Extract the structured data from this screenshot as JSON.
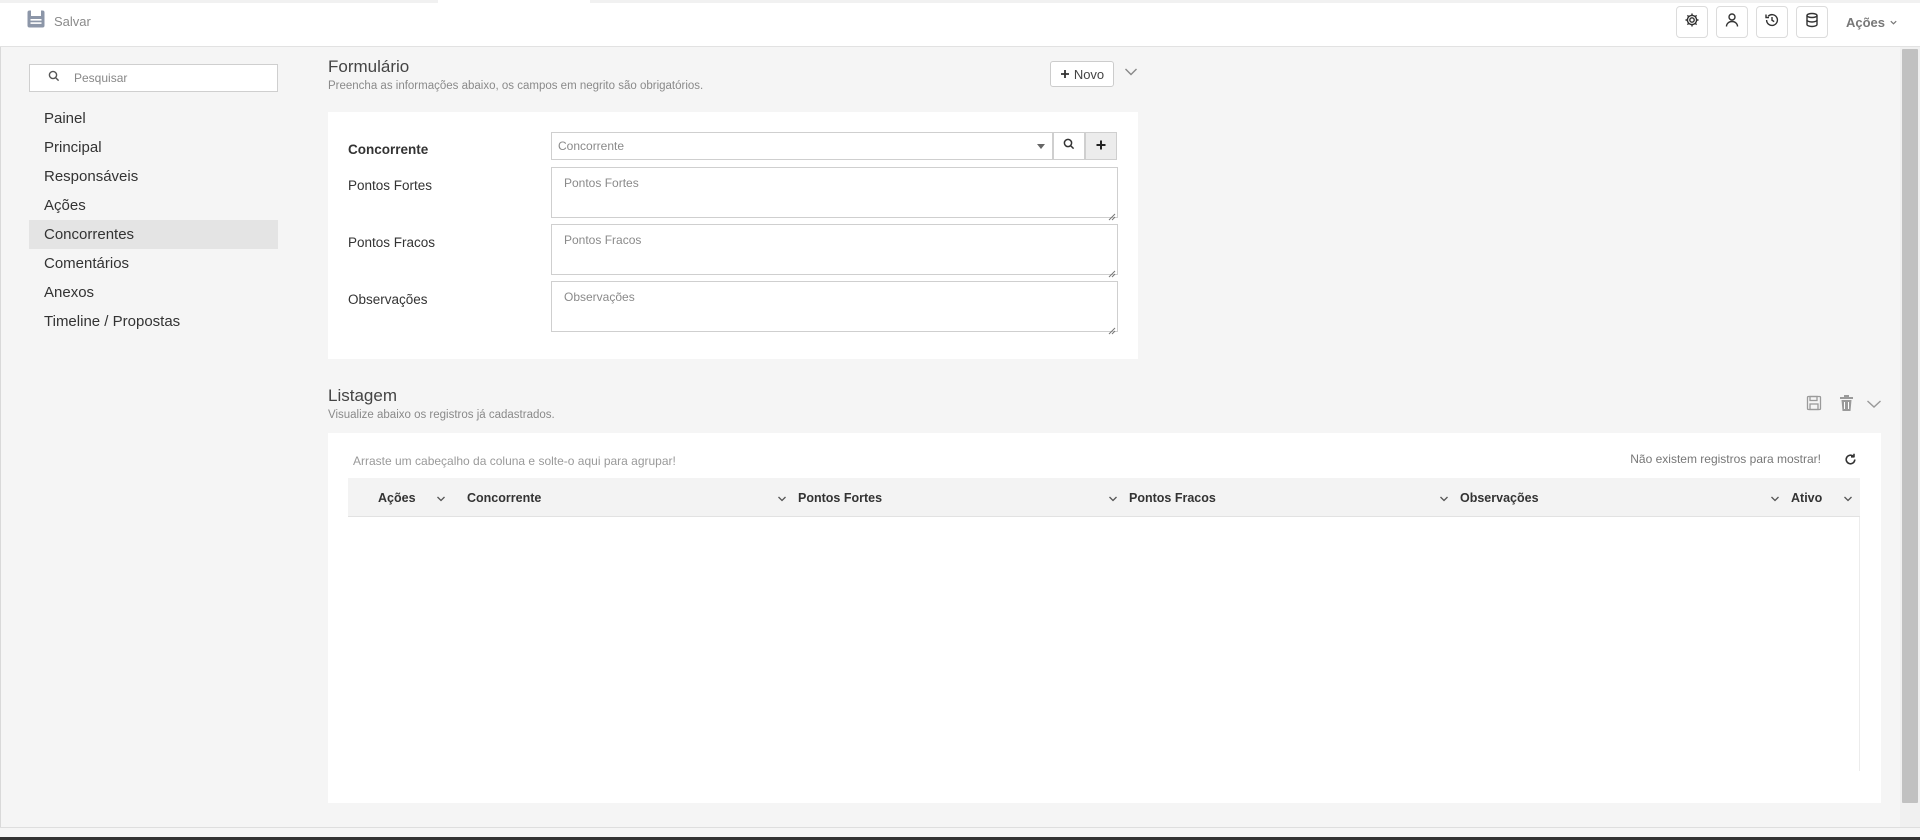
{
  "toolbar": {
    "save_label": "Salvar",
    "actions_label": "Ações",
    "icons": [
      "gear-icon",
      "user-icon",
      "history-icon",
      "database-icon"
    ]
  },
  "sidebar": {
    "search_placeholder": "Pesquisar",
    "items": [
      {
        "label": "Painel",
        "active": false
      },
      {
        "label": "Principal",
        "active": false
      },
      {
        "label": "Responsáveis",
        "active": false
      },
      {
        "label": "Ações",
        "active": false
      },
      {
        "label": "Concorrentes",
        "active": true
      },
      {
        "label": "Comentários",
        "active": false
      },
      {
        "label": "Anexos",
        "active": false
      },
      {
        "label": "Timeline / Propostas",
        "active": false
      }
    ]
  },
  "form": {
    "title": "Formulário",
    "subtitle": "Preencha as informações abaixo, os campos em negrito são obrigatórios.",
    "new_button": "Novo",
    "fields": {
      "concorrente": {
        "label": "Concorrente",
        "placeholder": "Concorrente"
      },
      "pontos_fortes": {
        "label": "Pontos Fortes",
        "placeholder": "Pontos Fortes"
      },
      "pontos_fracos": {
        "label": "Pontos Fracos",
        "placeholder": "Pontos Fracos"
      },
      "observacoes": {
        "label": "Observações",
        "placeholder": "Observações"
      }
    }
  },
  "listing": {
    "title": "Listagem",
    "subtitle": "Visualize abaixo os registros já cadastrados.",
    "group_hint": "Arraste um cabeçalho da coluna e solte-o aqui para agrupar!",
    "empty_message": "Não existem registros para mostrar!",
    "columns": [
      "Ações",
      "Concorrente",
      "Pontos Fortes",
      "Pontos Fracos",
      "Observações",
      "Ativo"
    ]
  },
  "colors": {
    "content_bg": "#f5f5f5",
    "card_bg": "#ffffff",
    "active_nav_bg": "#e4e4e4",
    "grid_header_bg": "#f3f3f3"
  }
}
